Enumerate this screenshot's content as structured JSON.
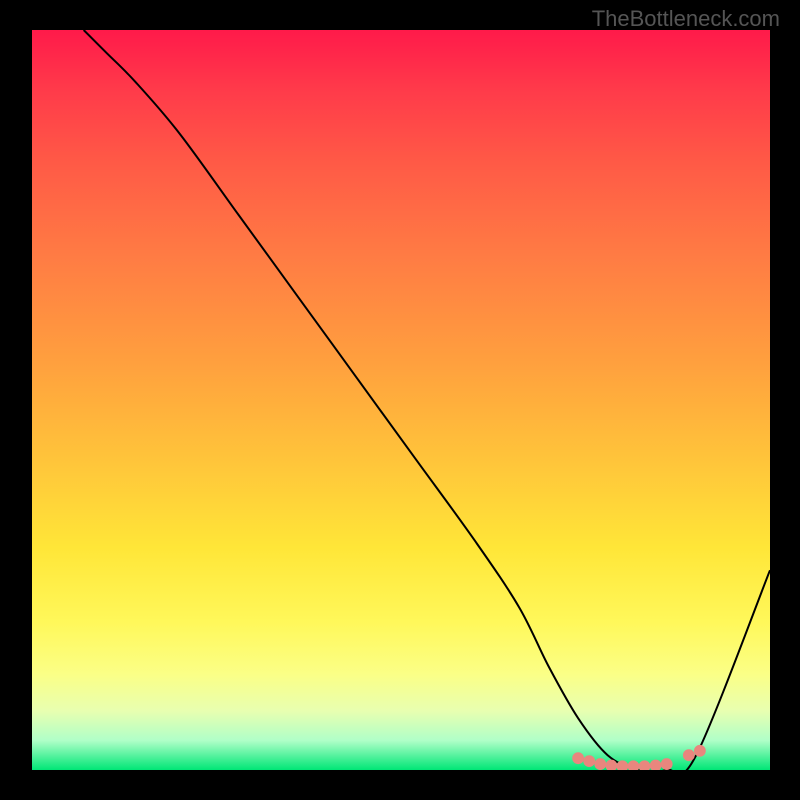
{
  "watermark": "TheBottleneck.com",
  "chart_data": {
    "type": "line",
    "title": "",
    "xlabel": "",
    "ylabel": "",
    "xlim": [
      0,
      100
    ],
    "ylim": [
      0,
      100
    ],
    "series": [
      {
        "name": "curve",
        "x": [
          7,
          10,
          14,
          20,
          28,
          36,
          44,
          52,
          60,
          66,
          70,
          74,
          78,
          82,
          86,
          90,
          100
        ],
        "y": [
          100,
          97,
          93,
          86,
          75,
          64,
          53,
          42,
          31,
          22,
          14,
          7,
          2,
          0,
          0,
          2,
          27
        ]
      }
    ],
    "markers": {
      "name": "bottom-dots",
      "x": [
        74,
        75.5,
        77,
        78.5,
        80,
        81.5,
        83,
        84.5,
        86,
        89,
        90.5
      ],
      "y": [
        1.6,
        1.2,
        0.8,
        0.6,
        0.5,
        0.5,
        0.5,
        0.6,
        0.8,
        2.0,
        2.6
      ],
      "color": "#e9867e"
    },
    "gradient_stops": [
      {
        "pos": 0,
        "color": "#ff1a4a"
      },
      {
        "pos": 18,
        "color": "#ff5a46"
      },
      {
        "pos": 45,
        "color": "#ffa03e"
      },
      {
        "pos": 70,
        "color": "#ffe638"
      },
      {
        "pos": 87,
        "color": "#fbff86"
      },
      {
        "pos": 96,
        "color": "#b0ffc8"
      },
      {
        "pos": 100,
        "color": "#00e676"
      }
    ]
  }
}
